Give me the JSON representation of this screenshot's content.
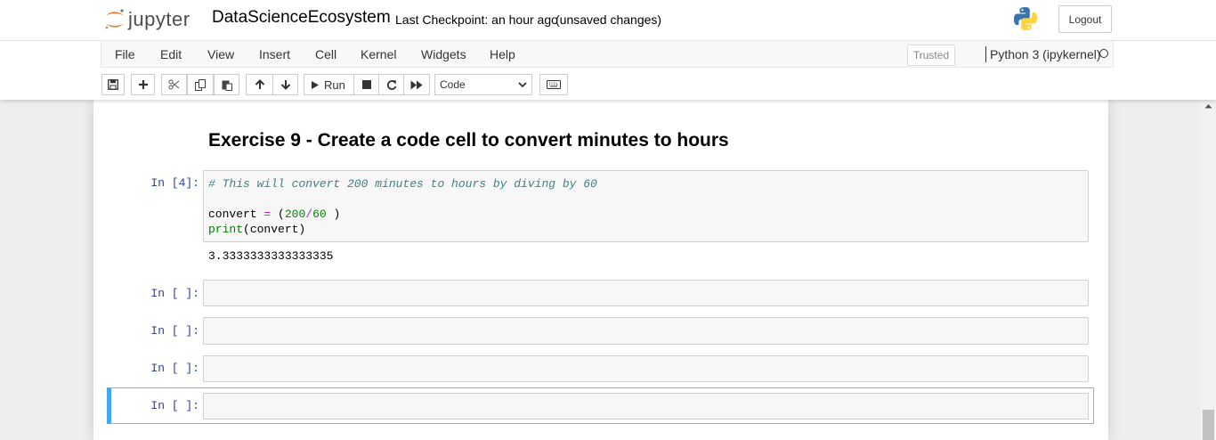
{
  "header": {
    "logo_text": "jupyter",
    "notebook_name": "DataScienceEcosystem",
    "checkpoint": "Last Checkpoint: an hour ago",
    "unsaved": "(unsaved changes)",
    "logout_label": "Logout"
  },
  "menubar": {
    "items": [
      "File",
      "Edit",
      "View",
      "Insert",
      "Cell",
      "Kernel",
      "Widgets",
      "Help"
    ],
    "trusted_label": "Trusted",
    "kernel_name": "Python 3 (ipykernel)"
  },
  "toolbar": {
    "run_label": "Run",
    "cell_type": "Code"
  },
  "notebook": {
    "heading": "Exercise 9 - Create a code cell to convert minutes to hours",
    "cells": [
      {
        "prompt": "In [4]:",
        "comment": "# This will convert 200 minutes to hours by diving by 60",
        "line2": "convert = (200/60 )",
        "line3": "print(convert)",
        "output": "3.3333333333333335"
      },
      {
        "prompt": "In [ ]:"
      },
      {
        "prompt": "In [ ]:"
      },
      {
        "prompt": "In [ ]:"
      },
      {
        "prompt": "In [ ]:"
      }
    ]
  },
  "colors": {
    "prompt": "#303f9f",
    "selected_border": "#42a5f5",
    "code_comment": "#408080",
    "number": "#008800",
    "operator": "#aa22ff"
  }
}
